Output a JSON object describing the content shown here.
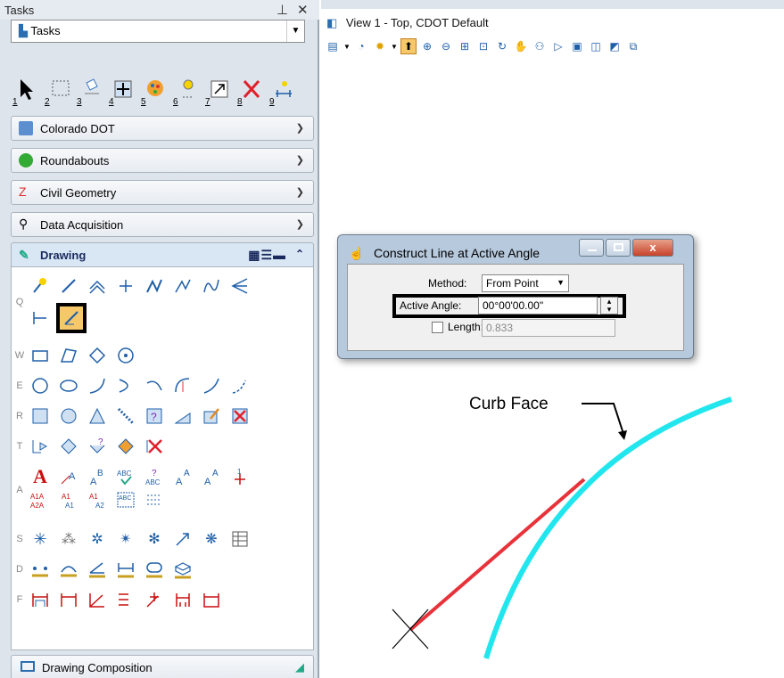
{
  "tasks_panel": {
    "title": "Tasks",
    "pin_glyph": "ᵖ",
    "close_glyph": "✕",
    "dropdown_value": "Tasks",
    "tool_numbers": [
      "1",
      "2",
      "3",
      "4",
      "5",
      "6",
      "7",
      "8",
      "9"
    ],
    "groups": [
      {
        "label": "Colorado DOT",
        "icon": "cdot-logo-icon"
      },
      {
        "label": "Roundabouts",
        "icon": "roundabout-icon"
      },
      {
        "label": "Civil Geometry",
        "icon": "civil-geometry-icon"
      },
      {
        "label": "Data Acquisition",
        "icon": "data-acquisition-icon"
      }
    ],
    "drawing": {
      "label": "Drawing",
      "row_letters": [
        "Q",
        "W",
        "E",
        "R",
        "T",
        "A",
        "S",
        "D",
        "F"
      ]
    },
    "drawing_composition": "Drawing Composition"
  },
  "view": {
    "title": "View 1 - Top, CDOT Default"
  },
  "dialog": {
    "title": "Construct Line at Active Angle",
    "method_label": "Method:",
    "method_value": "From Point",
    "angle_label": "Active Angle:",
    "angle_value": "00°00'00.00\"",
    "length_label": "Length:",
    "length_value": "0.833"
  },
  "canvas": {
    "annotation": "Curb Face"
  },
  "colors": {
    "curb": "#22e6ee",
    "line": "#e8323a",
    "highlight": "#000000",
    "accent": "#1f5fa8"
  }
}
